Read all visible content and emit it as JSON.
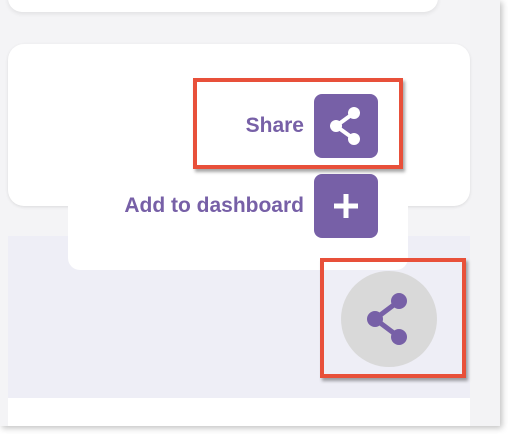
{
  "share_menu": {
    "share_label": "Share",
    "share_icon": "share-icon",
    "add_to_dashboard_label": "Add to dashboard",
    "add_icon": "plus-icon"
  },
  "fab": {
    "icon": "share-icon"
  },
  "colors": {
    "accent": "#7760a7",
    "highlight": "#e8503a",
    "fab_background": "#d9d9d9"
  }
}
